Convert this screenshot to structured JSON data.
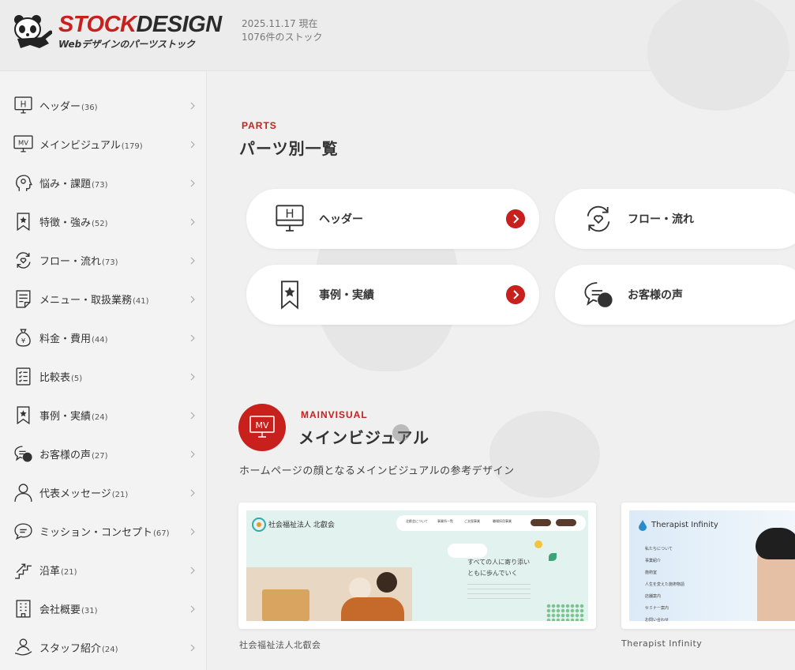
{
  "header": {
    "logo_main_a": "STOCK",
    "logo_main_b": "DESIGN",
    "logo_sub": "Webデザインのパーツストック",
    "date_line": "2025.11.17 現在",
    "count_line": "1076件のストック"
  },
  "colors": {
    "accent": "#c8201c",
    "background": "#f0f0f0",
    "card": "#ffffff"
  },
  "sidebar": {
    "items": [
      {
        "label": "ヘッダー",
        "count": "(36)",
        "icon": "header-icon"
      },
      {
        "label": "メインビジュアル",
        "count": "(179)",
        "icon": "mv-icon"
      },
      {
        "label": "悩み・課題",
        "count": "(73)",
        "icon": "thinking-head-icon"
      },
      {
        "label": "特徴・強み",
        "count": "(52)",
        "icon": "star-bookmark-icon"
      },
      {
        "label": "フロー・流れ",
        "count": "(73)",
        "icon": "flow-cycle-icon"
      },
      {
        "label": "メニュー・取扱業務",
        "count": "(41)",
        "icon": "menu-document-icon"
      },
      {
        "label": "料金・費用",
        "count": "(44)",
        "icon": "money-bag-icon"
      },
      {
        "label": "比較表",
        "count": "(5)",
        "icon": "checklist-icon"
      },
      {
        "label": "事例・実績",
        "count": "(24)",
        "icon": "star-bookmark-icon"
      },
      {
        "label": "お客様の声",
        "count": "(27)",
        "icon": "speech-bubbles-icon"
      },
      {
        "label": "代表メッセージ",
        "count": "(21)",
        "icon": "person-icon"
      },
      {
        "label": "ミッション・コンセプト",
        "count": "(67)",
        "icon": "speech-bubble-icon"
      },
      {
        "label": "沿革",
        "count": "(21)",
        "icon": "growth-stairs-icon"
      },
      {
        "label": "会社概要",
        "count": "(31)",
        "icon": "building-icon"
      },
      {
        "label": "スタッフ紹介",
        "count": "(24)",
        "icon": "staff-hand-icon"
      }
    ]
  },
  "parts": {
    "en": "PARTS",
    "title": "パーツ別一覧",
    "cards": [
      {
        "label": "ヘッダー",
        "icon": "header-icon"
      },
      {
        "label": "フロー・流れ",
        "icon": "flow-cycle-icon"
      },
      {
        "label": "事例・実績",
        "icon": "star-bookmark-icon"
      },
      {
        "label": "お客様の声",
        "icon": "speech-bubbles-icon"
      }
    ]
  },
  "mainvisual": {
    "badge": "MV",
    "en": "MAINVISUAL",
    "title": "メインビジュアル",
    "desc": "ホームページの顔となるメインビジュアルの参考デザイン",
    "thumbs": [
      {
        "caption": "社会福祉法人北叡会",
        "site_logo": "社会福祉法人 北叡会",
        "nav": [
          "北叡会について",
          "事業所一覧",
          "ご支援事業",
          "職場採用事業"
        ],
        "headline1": "すべての人に寄り添い",
        "headline2": "ともに歩んでいく"
      },
      {
        "caption": "Therapist Infinity",
        "site_logo": "Therapist Infinity",
        "nav": [
          "私たちについて",
          "事業紹介",
          "施術室",
          "人生を変えた施術物語",
          "店舗案内",
          "セミナー案内",
          "お問い合わせ"
        ]
      }
    ]
  }
}
